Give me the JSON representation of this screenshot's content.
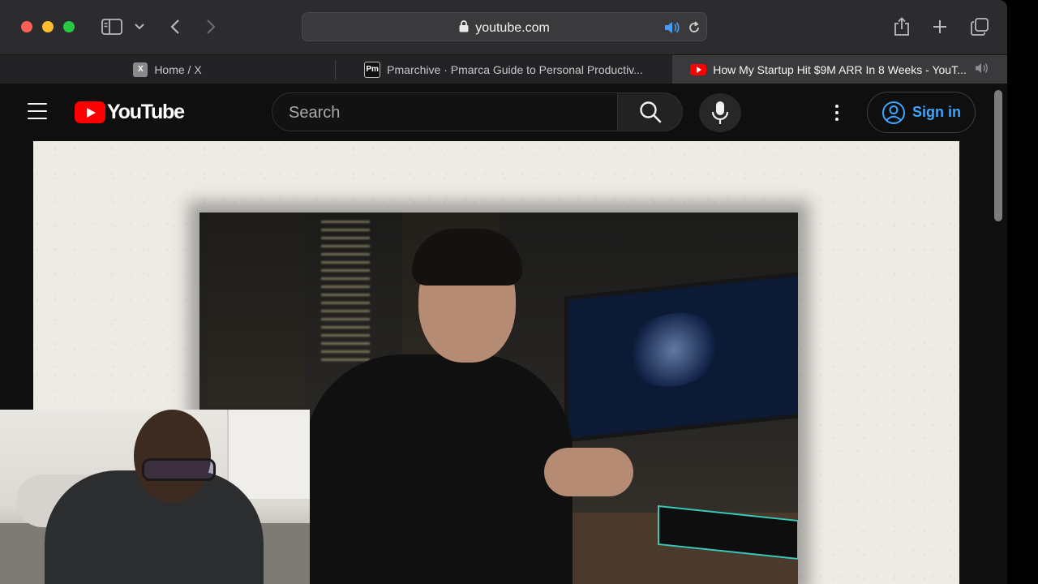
{
  "browser": {
    "address": "youtube.com",
    "tabs": [
      {
        "label": "Home / X",
        "favicon": "X",
        "active": false
      },
      {
        "label": "Pmarchive · Pmarca Guide to Personal Productiv...",
        "favicon": "Pm",
        "active": false
      },
      {
        "label": "How My Startup Hit $9M ARR In 8 Weeks - YouT...",
        "favicon": "youtube-icon",
        "active": true
      }
    ]
  },
  "youtube": {
    "logo_text": "YouTube",
    "search_placeholder": "Search",
    "sign_in_label": "Sign in"
  },
  "colors": {
    "youtube_red": "#ff0000",
    "sign_in_blue": "#3ea6ff",
    "page_bg": "#0f0f0f"
  }
}
